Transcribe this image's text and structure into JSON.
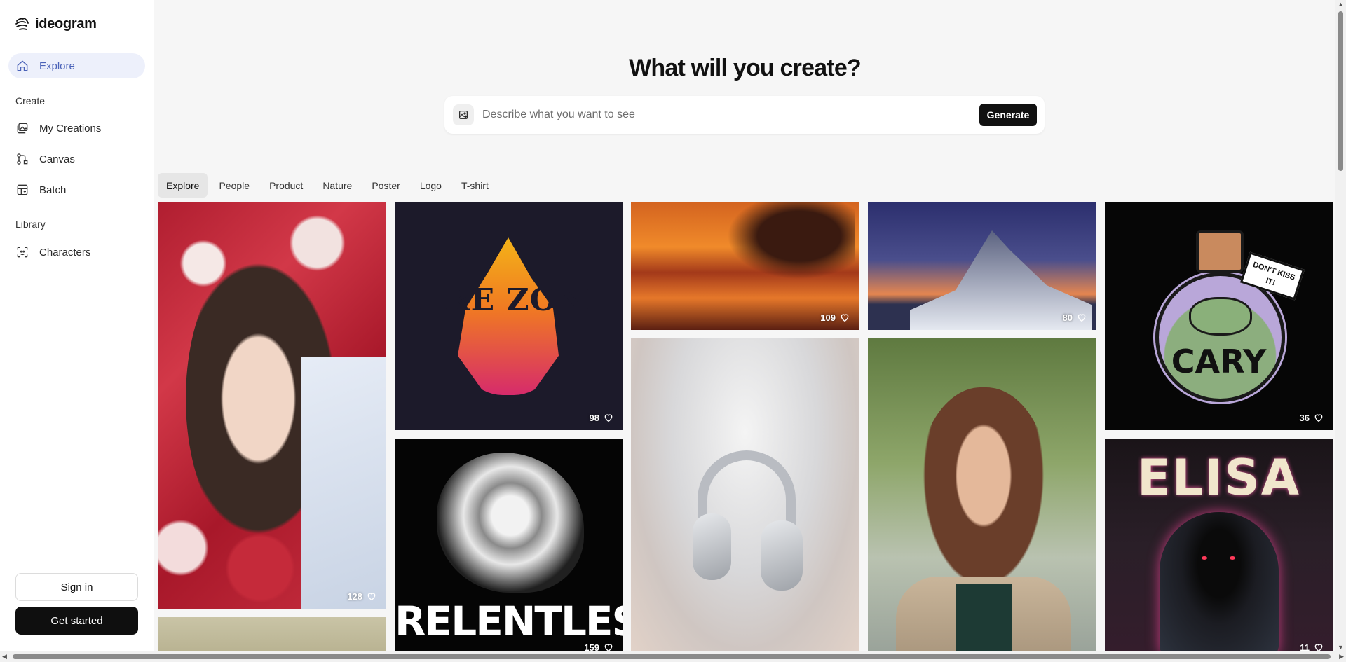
{
  "brand": {
    "name": "ideogram"
  },
  "sidebar": {
    "explore_label": "Explore",
    "create_section": "Create",
    "create_items": [
      {
        "label": "My Creations",
        "icon": "images-icon"
      },
      {
        "label": "Canvas",
        "icon": "canvas-icon"
      },
      {
        "label": "Batch",
        "icon": "batch-icon"
      }
    ],
    "library_section": "Library",
    "library_items": [
      {
        "label": "Characters",
        "icon": "characters-icon"
      }
    ],
    "sign_in": "Sign in",
    "get_started": "Get started"
  },
  "main": {
    "headline": "What will you create?",
    "search": {
      "placeholder": "Describe what you want to see",
      "value": ""
    },
    "generate": "Generate",
    "tabs": [
      "Explore",
      "People",
      "Product",
      "Nature",
      "Poster",
      "Logo",
      "T-shirt"
    ],
    "active_tab": "Explore"
  },
  "gallery": [
    {
      "id": "woman-roses",
      "likes": "128"
    },
    {
      "id": "fire-zone-logo",
      "likes": "98",
      "text": "FIRE ZONE"
    },
    {
      "id": "relentless-bull",
      "likes": "159",
      "text": "RELENTLESS"
    },
    {
      "id": "sunset-tree",
      "likes": "109"
    },
    {
      "id": "headphones",
      "likes": ""
    },
    {
      "id": "snowy-mountain",
      "likes": "80"
    },
    {
      "id": "woman-portrait",
      "likes": ""
    },
    {
      "id": "cary-potion",
      "likes": "36",
      "text": "CARY",
      "badge": "DON'T KISS IT!"
    },
    {
      "id": "elisa-hoodie",
      "likes": "11",
      "text": "ELISA"
    },
    {
      "id": "extra-bottom",
      "likes": ""
    }
  ],
  "colors": {
    "accent": "#4a62b8",
    "active_nav_bg": "#edf0fb",
    "dark": "#0f0f0f"
  }
}
